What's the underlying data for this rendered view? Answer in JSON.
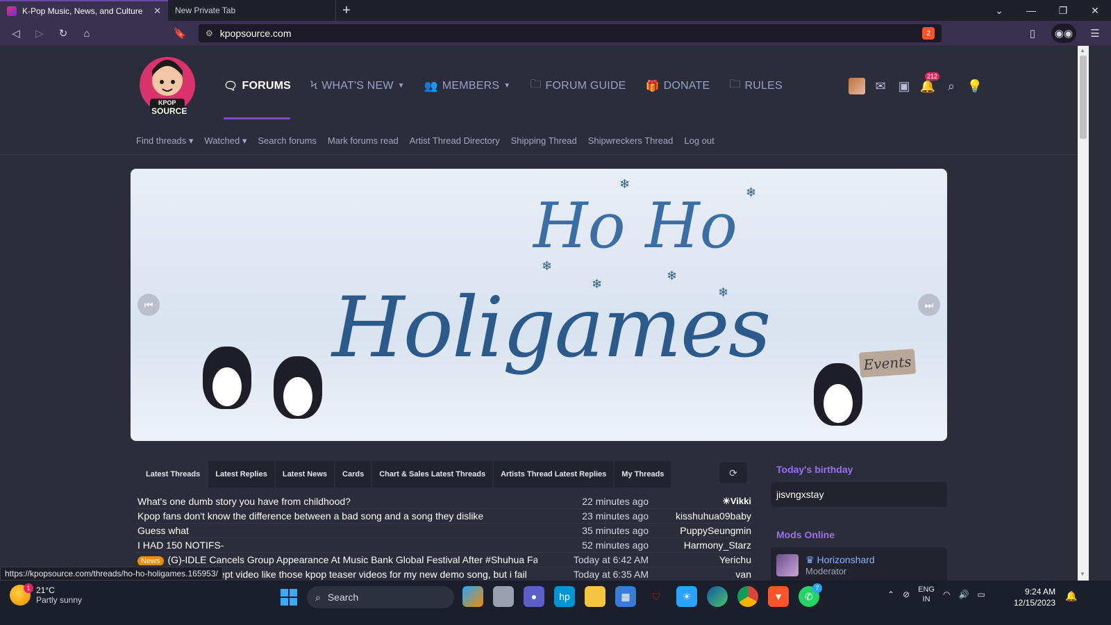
{
  "browser": {
    "tabs": [
      {
        "title": "K-Pop Music, News, and Culture",
        "active": true
      },
      {
        "title": "New Private Tab",
        "active": false
      }
    ],
    "new_tab": "+",
    "url": "kpopsource.com",
    "shield_count": "2"
  },
  "site": {
    "nav": [
      {
        "label": "FORUMS",
        "icon": "chat-icon",
        "active": true
      },
      {
        "label": "WHAT'S NEW",
        "icon": "bolt-icon",
        "dropdown": true
      },
      {
        "label": "MEMBERS",
        "icon": "users-icon",
        "dropdown": true
      },
      {
        "label": "FORUM GUIDE",
        "icon": "folder-icon"
      },
      {
        "label": "DONATE",
        "icon": "gift-icon"
      },
      {
        "label": "RULES",
        "icon": "folder-icon"
      }
    ],
    "notifications_count": "212",
    "subnav": [
      "Find threads",
      "Watched",
      "Search forums",
      "Mark forums read",
      "Artist Thread Directory",
      "Shipping Thread",
      "Shipwreckers Thread",
      "Log out"
    ],
    "logo": {
      "line1": "KPOP",
      "line2": "SOURCE"
    }
  },
  "banner": {
    "line1": "Ho Ho",
    "line2": "Holigames",
    "sign": "Events"
  },
  "thread_tabs": [
    "Latest Threads",
    "Latest Replies",
    "Latest News",
    "Cards",
    "Chart & Sales Latest Threads",
    "Artists Thread Latest Replies",
    "My Threads"
  ],
  "threads": [
    {
      "title": "What's one dumb story you have from childhood?",
      "time": "22 minutes ago",
      "user": "Vikki",
      "special": true
    },
    {
      "title": "Kpop fans don't know the difference between a bad song and a song they dislike",
      "time": "23 minutes ago",
      "user": "kisshuhua09baby"
    },
    {
      "title": "Guess what",
      "time": "35 minutes ago",
      "user": "PuppySeungmin"
    },
    {
      "title": "I HAD 150 NOTIFS-",
      "time": "52 minutes ago",
      "user": "Harmony_Starz"
    },
    {
      "title": "(G)-IDLE Cancels Group Appearance At Music Bank Global Festival After #Shuhua Falls III",
      "time": "Today at 6:42 AM",
      "user": "Yerichu",
      "badge": "News"
    },
    {
      "title": "ept video like those kpop teaser videos for my new demo song, but i fail",
      "time": "Today at 6:35 AM",
      "user": "van"
    }
  ],
  "sidebar": {
    "birthday_head": "Today's birthday",
    "birthday_user": "jisvngxstay",
    "mods_head": "Mods Online",
    "mod_name": "Horizonshard",
    "mod_role": "Moderator"
  },
  "status_url": "https://kpopsource.com/threads/ho-ho-holigames.165953/",
  "taskbar": {
    "temp": "21°C",
    "condition": "Partly sunny",
    "weather_badge": "1",
    "search": "Search",
    "whatsapp_badge": "7",
    "lang1": "ENG",
    "lang2": "IN",
    "time": "9:24 AM",
    "date": "12/15/2023"
  }
}
